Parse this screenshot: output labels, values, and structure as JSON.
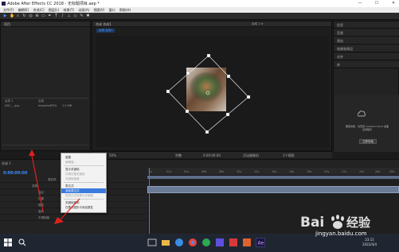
{
  "window": {
    "title": "Adobe After Effects CC 2018 - 无标题项目.aep *",
    "minimize_glyph": "—",
    "maximize_glyph": "☐",
    "close_glyph": "✕"
  },
  "menubar": {
    "items": [
      "文件(F)",
      "编辑(E)",
      "合成(C)",
      "图层(L)",
      "效果(T)",
      "动画(A)",
      "视图(V)",
      "窗口",
      "帮助(H)"
    ]
  },
  "project_panel": {
    "title": "项目",
    "rows": [
      {
        "name": "合成 1",
        "type": "合成",
        "size": ""
      },
      {
        "name": "DSC_...jpg",
        "type": "ImporterJPEG",
        "size": "1.0 MB"
      }
    ]
  },
  "composition_panel": {
    "tab_label": "合成 合成1",
    "breadcrumb": "合成 1 ≡"
  },
  "right_panel": {
    "sections": [
      "信息",
      "音频",
      "预览",
      "效果和预设",
      "对齐",
      "库"
    ],
    "cc_message": "要使用库，请安装 Creative Cloud 桌面应用程序",
    "cc_button": "立即安装"
  },
  "viewer_bar": {
    "zoom": "50%",
    "resolution": "完整",
    "timecode": "0:00:00:00",
    "camera": "活动摄像机",
    "views": "1个视图"
  },
  "timeline": {
    "tab": "合成 1",
    "timecode": "0:00:00:00",
    "ruler_labels": [
      "0s",
      "02s",
      "04s",
      "06s",
      "08s",
      "10s",
      "12s",
      "14s",
      "16s",
      "18s",
      "20s",
      "22s",
      "24s",
      "26s",
      "28s"
    ],
    "layer_rows": [
      "源名称",
      "变换",
      "锚点",
      "位置",
      "缩放",
      "旋转",
      "不透明度"
    ]
  },
  "context_menu": {
    "items": [
      {
        "label": "重置",
        "state": "normal"
      },
      {
        "label": "编辑值...",
        "state": "disabled"
      },
      {
        "label": "",
        "state": "separator"
      },
      {
        "label": "显示关键帧",
        "state": "normal"
      },
      {
        "label": "切换定格关键帧",
        "state": "disabled"
      },
      {
        "label": "关键帧插值",
        "state": "disabled"
      },
      {
        "label": "",
        "state": "separator"
      },
      {
        "label": "表达式",
        "state": "normal"
      },
      {
        "label": "添加表达式",
        "state": "highlighted"
      },
      {
        "label": "将表达式转换为关键帧",
        "state": "disabled"
      },
      {
        "label": "",
        "state": "separator"
      },
      {
        "label": "关键帧辅助",
        "state": "normal"
      },
      {
        "label": "在基本图形中添加属性",
        "state": "normal"
      }
    ]
  },
  "taskbar": {
    "time": "23:11",
    "date": "2022/4/4"
  },
  "watermark": {
    "url": "jingyan.baidu.com"
  },
  "colors": {
    "accent": "#3b7be0",
    "timecode": "#3d8bff",
    "annotation_arrow": "#e02020"
  }
}
